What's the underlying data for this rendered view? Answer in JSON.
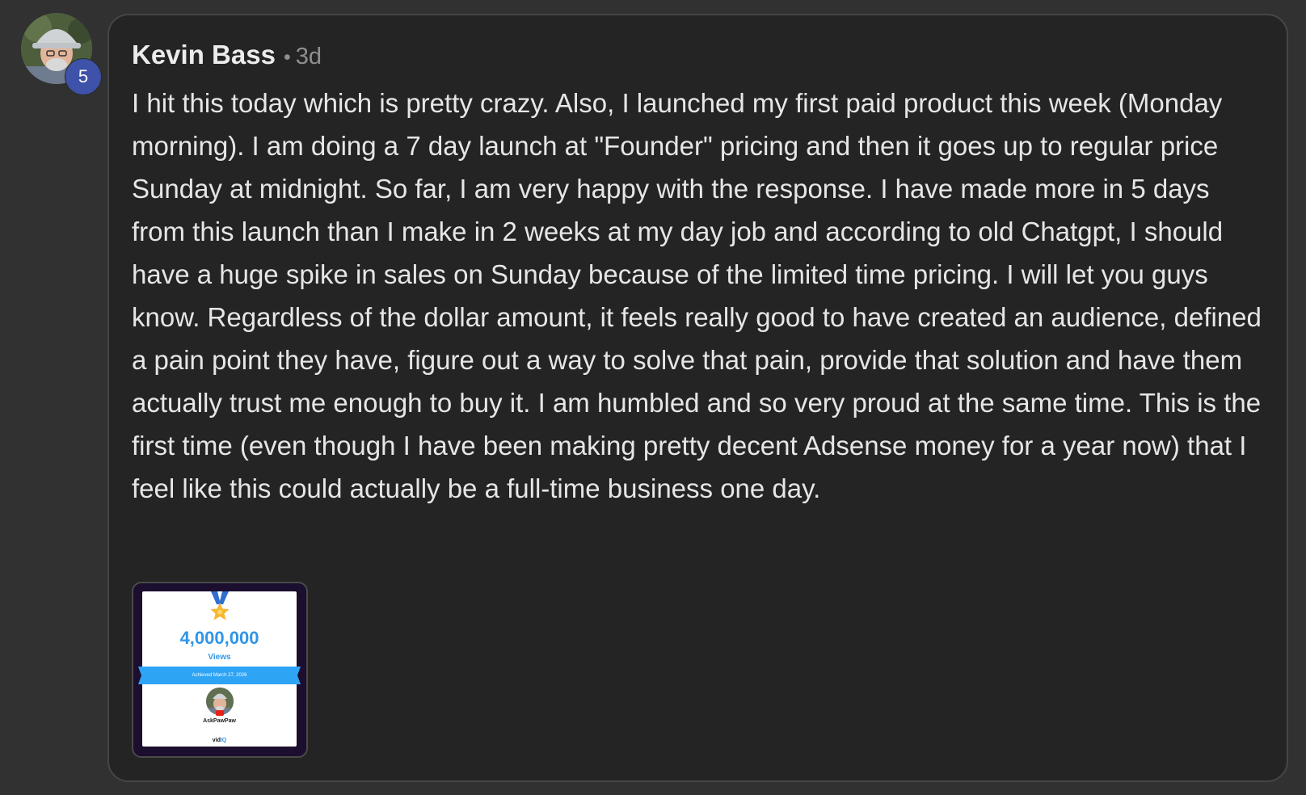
{
  "author": {
    "name": "Kevin Bass",
    "level": "5",
    "avatar_icon": "user-avatar-photo"
  },
  "post": {
    "separator": "•",
    "time": "3d",
    "body": "I hit this today which is pretty crazy. Also, I launched my first paid product this week (Monday morning). I am doing a 7 day launch at \"Founder\" pricing and then it goes up to regular price Sunday at midnight. So far, I am very happy with the response. I have made more in 5 days from this launch than I make in 2 weeks at my day job and according to old Chatgpt, I should have a huge spike in sales on Sunday because of the limited time pricing. I will let you guys know. Regardless of the dollar amount, it feels really good to have created an audience, defined a pain point they have, figure out a way to solve that pain, provide that solution and have them actually trust me enough to buy it. I am humbled and so very proud at the same time. This is the first time (even though I have been making pretty decent Adsense money for a year now) that I feel like this could actually be a full-time business one day."
  },
  "attachment": {
    "number": "4,000,000",
    "unit": "Views",
    "achieved": "Achieved March 27, 2026",
    "channel": "AskPawPaw",
    "brand_prefix": "vid",
    "brand_accent": "IQ",
    "medal_icon": "medal-star-icon"
  },
  "colors": {
    "background": "#313131",
    "card": "#242424",
    "badge": "#3d52a8",
    "accent": "#2f95e8"
  }
}
